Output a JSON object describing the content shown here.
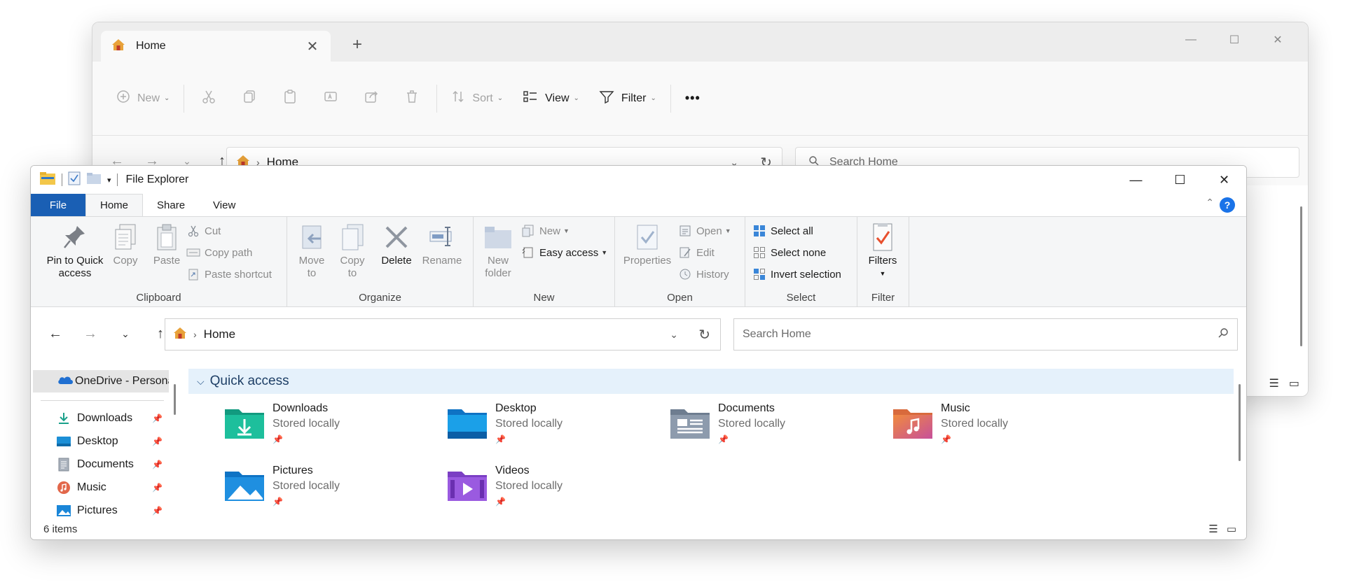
{
  "back_window": {
    "tab_label": "Home",
    "toolbar": {
      "new_label": "New",
      "sort_label": "Sort",
      "view_label": "View",
      "filter_label": "Filter",
      "more_label": "•••"
    },
    "address": {
      "crumb": "Home"
    },
    "search": {
      "placeholder": "Search Home"
    }
  },
  "front_window": {
    "title": "File Explorer",
    "tabs": [
      {
        "label": "File"
      },
      {
        "label": "Home"
      },
      {
        "label": "Share"
      },
      {
        "label": "View"
      }
    ],
    "help_label": "?",
    "ribbon": {
      "clipboard": {
        "label": "Clipboard",
        "pin_to_quick_access": "Pin to Quick access",
        "copy": "Copy",
        "paste": "Paste",
        "cut": "Cut",
        "copy_path": "Copy path",
        "paste_shortcut": "Paste shortcut"
      },
      "organize": {
        "label": "Organize",
        "move_to": "Move to",
        "copy_to": "Copy to",
        "delete": "Delete",
        "rename": "Rename"
      },
      "new": {
        "label": "New",
        "new_folder": "New folder",
        "new_item": "New",
        "easy_access": "Easy access"
      },
      "open": {
        "label": "Open",
        "properties": "Properties",
        "open_item": "Open",
        "edit": "Edit",
        "history": "History"
      },
      "select": {
        "label": "Select",
        "select_all": "Select all",
        "select_none": "Select none",
        "invert_selection": "Invert selection"
      },
      "filter": {
        "label": "Filter",
        "filters": "Filters"
      }
    },
    "address": {
      "crumb": "Home"
    },
    "search": {
      "placeholder": "Search Home"
    },
    "nav_pane": {
      "onedrive_label": "OneDrive - Personal",
      "items": [
        {
          "label": "Downloads",
          "icon": "download-icon"
        },
        {
          "label": "Desktop",
          "icon": "desktop-icon"
        },
        {
          "label": "Documents",
          "icon": "documents-icon"
        },
        {
          "label": "Music",
          "icon": "music-icon"
        },
        {
          "label": "Pictures",
          "icon": "pictures-icon"
        }
      ]
    },
    "quick_access": {
      "header": "Quick access",
      "folders": [
        {
          "name": "Downloads",
          "status": "Stored locally"
        },
        {
          "name": "Desktop",
          "status": "Stored locally"
        },
        {
          "name": "Documents",
          "status": "Stored locally"
        },
        {
          "name": "Music",
          "status": "Stored locally"
        },
        {
          "name": "Pictures",
          "status": "Stored locally"
        },
        {
          "name": "Videos",
          "status": "Stored locally"
        }
      ]
    },
    "status_bar": {
      "item_count": "6 items"
    }
  },
  "colors": {
    "file_tab": "#1a5fb4",
    "quick_access_header_bg": "#e5f1fb",
    "help_button": "#1a73e8"
  }
}
